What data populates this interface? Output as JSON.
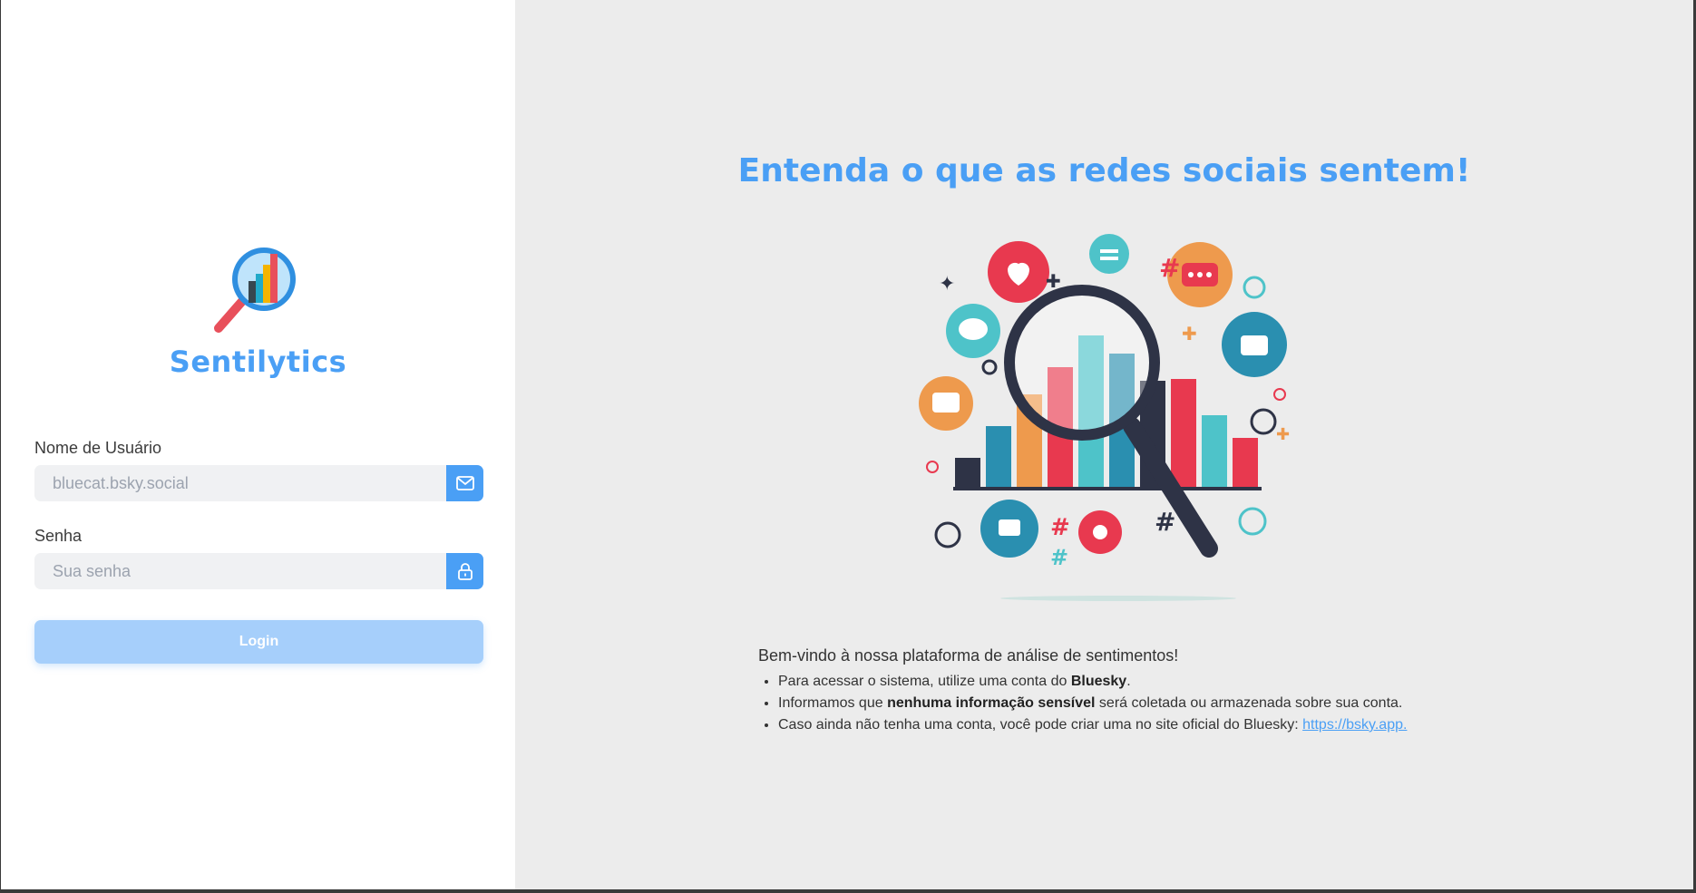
{
  "app": {
    "brand_name": "Sentilytics"
  },
  "login_form": {
    "username_label": "Nome de Usuário",
    "username_placeholder": "bluecat.bsky.social",
    "password_label": "Senha",
    "password_placeholder": "Sua senha",
    "login_button": "Login"
  },
  "hero": {
    "headline": "Entenda o que as redes sociais sentem!",
    "intro": "Bem-vindo à nossa plataforma de análise de sentimentos!",
    "bullets": [
      {
        "before": "Para acessar o sistema, utilize uma conta do ",
        "bold": "Bluesky",
        "after": "."
      },
      {
        "before": "Informamos que ",
        "bold": "nenhuma informação sensível",
        "after": " será coletada ou armazenada sobre sua conta."
      },
      {
        "before": "Caso ainda não tenha uma conta, você pode criar uma no site oficial do Bluesky: ",
        "link": "https://bsky.app."
      }
    ]
  },
  "icons": {
    "logo": "magnifier-bar-chart-logo",
    "username_button": "mail-icon",
    "password_button": "lock-icon",
    "illustration": "social-media-sentiment-illustration"
  },
  "colors": {
    "accent": "#4a9ff5",
    "login_button": "#a6cffb",
    "right_background": "#ececec"
  }
}
